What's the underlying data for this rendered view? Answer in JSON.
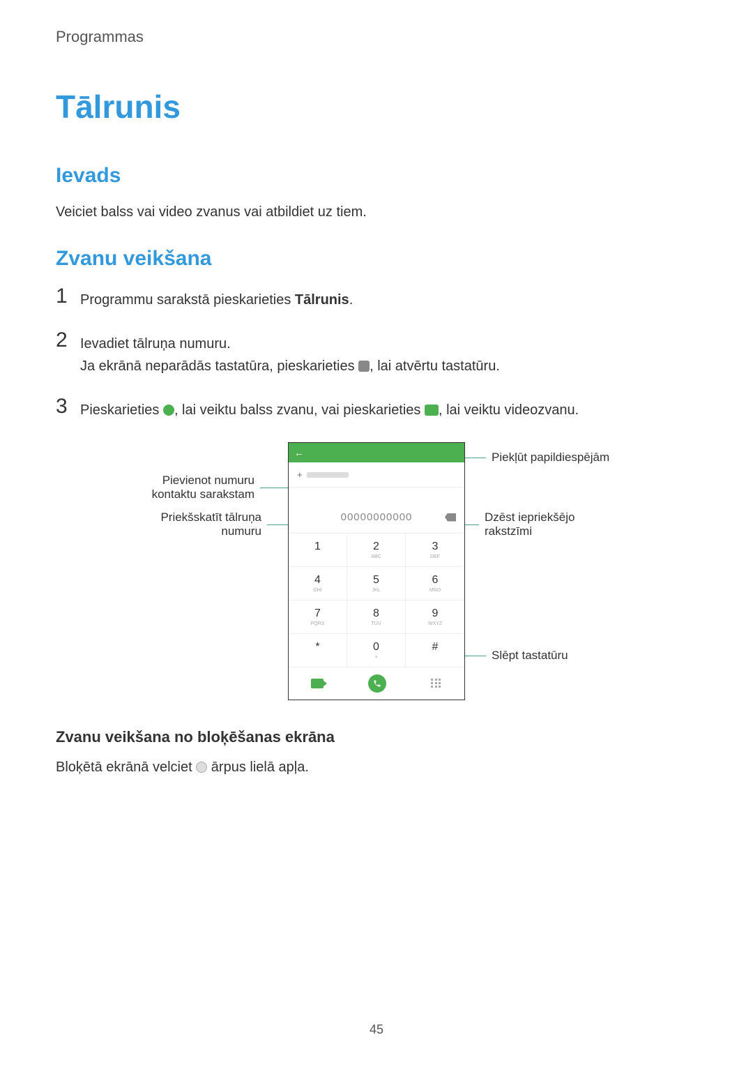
{
  "header": {
    "section_label": "Programmas"
  },
  "main_title": "Tālrunis",
  "intro": {
    "heading": "Ievads",
    "text": "Veiciet balss vai video zvanus vai atbildiet uz tiem."
  },
  "making_calls": {
    "heading": "Zvanu veikšana",
    "step1_prefix": "Programmu sarakstā pieskarieties ",
    "step1_bold": "Tālrunis",
    "step1_suffix": ".",
    "step2_line1": "Ievadiet tālruņa numuru.",
    "step2_line2_prefix": "Ja ekrānā neparādās tastatūra, pieskarieties ",
    "step2_line2_suffix": ", lai atvērtu tastatūru.",
    "step3_prefix": "Pieskarieties ",
    "step3_mid": ", lai veiktu balss zvanu, vai pieskarieties ",
    "step3_suffix": ", lai veiktu videozvanu."
  },
  "diagram": {
    "label_add_contact": "Pievienot numuru kontaktu sarakstam",
    "label_preview_number": "Priekšskatīt tālruņa numuru",
    "label_more_options": "Piekļūt papildiespējām",
    "label_delete_char": "Dzēst iepriekšējo rakstzīmi",
    "label_hide_keyboard": "Slēpt tastatūru",
    "phone_number": "00000000000",
    "keys": [
      {
        "digit": "1",
        "letters": ""
      },
      {
        "digit": "2",
        "letters": "ABC"
      },
      {
        "digit": "3",
        "letters": "DEF"
      },
      {
        "digit": "4",
        "letters": "GHI"
      },
      {
        "digit": "5",
        "letters": "JKL"
      },
      {
        "digit": "6",
        "letters": "MNO"
      },
      {
        "digit": "7",
        "letters": "PQRS"
      },
      {
        "digit": "8",
        "letters": "TUV"
      },
      {
        "digit": "9",
        "letters": "WXYZ"
      },
      {
        "digit": "*",
        "letters": ""
      },
      {
        "digit": "0",
        "letters": "+"
      },
      {
        "digit": "#",
        "letters": ""
      }
    ]
  },
  "lock_screen": {
    "heading": "Zvanu veikšana no bloķēšanas ekrāna",
    "text_prefix": "Bloķētā ekrānā velciet ",
    "text_suffix": " ārpus lielā apļa."
  },
  "page_number": "45"
}
